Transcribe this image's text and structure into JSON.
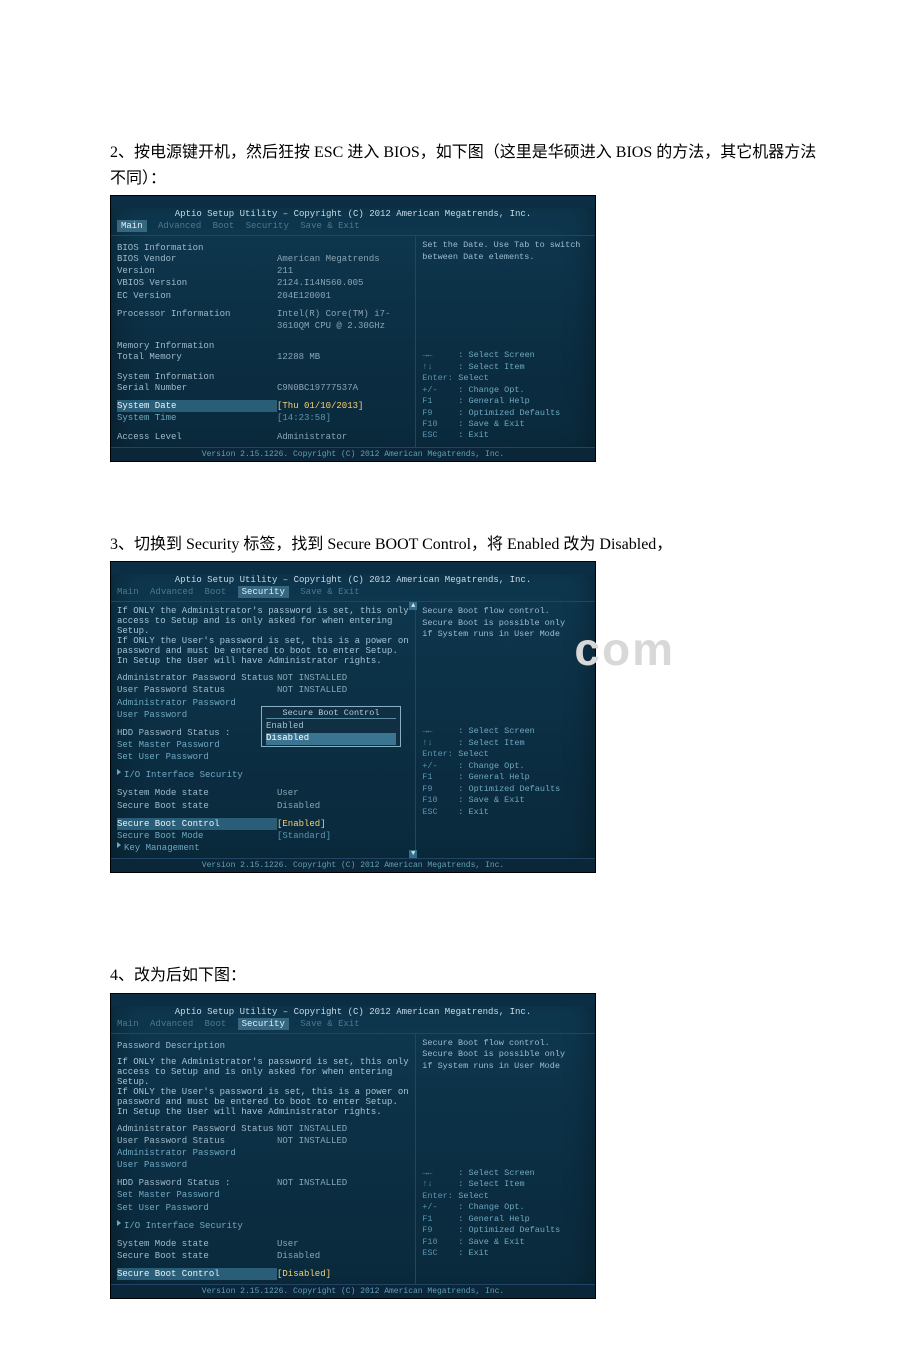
{
  "step2": {
    "caption": "2、按电源键开机，然后狂按 ESC 进入 BIOS，如下图（这里是华硕进入 BIOS 的方法，其它机器方法不同）：",
    "title": "Aptio Setup Utility – Copyright (C) 2012 American Megatrends, Inc.",
    "tabs": {
      "active": "Main",
      "others": [
        "Advanced",
        "Boot",
        "Security",
        "Save & Exit"
      ]
    },
    "left": {
      "h0": "BIOS Information",
      "r1k": "BIOS Vendor",
      "r1v": "American Megatrends",
      "r2k": "Version",
      "r2v": "211",
      "r3k": "VBIOS Version",
      "r3v": "2124.I14N560.005",
      "r4k": "EC Version",
      "r4v": "204E120001",
      "r5k": "Processor Information",
      "r5v": "Intel(R) Core(TM) i7-3610QM CPU @ 2.30GHz",
      "h1": "Memory Information",
      "r6k": "Total Memory",
      "r6v": "12288 MB",
      "h2": "System Information",
      "r7k": "Serial Number",
      "r7v": "C9N0BC19777537A",
      "r8k": "System Date",
      "r8v": "[Thu 01/10/2013]",
      "r9k": "System Time",
      "r9v": "[14:23:58]",
      "r10k": "Access Level",
      "r10v": "Administrator"
    },
    "right": {
      "help": "Set the Date. Use Tab to switch between Date elements.",
      "keys": {
        "k1": "→←",
        "d1": ": Select Screen",
        "k2": "↑↓",
        "d2": ": Select Item",
        "k3": "Enter:",
        "d3": "Select",
        "k4": "+/-",
        "d4": ": Change Opt.",
        "k5": "F1",
        "d5": ": General Help",
        "k6": "F9",
        "d6": ": Optimized Defaults",
        "k7": "F10",
        "d7": ": Save & Exit",
        "k8": "ESC",
        "d8": ": Exit"
      }
    },
    "footer": "Version 2.15.1226. Copyright (C) 2012 American Megatrends, Inc."
  },
  "step3": {
    "caption": "3、切换到 Security 标签，找到 Secure BOOT Control，将 Enabled 改为 Disabled，",
    "title": "Aptio Setup Utility – Copyright (C) 2012 American Megatrends, Inc.",
    "tabs": {
      "active": "Security",
      "before": [
        "Main",
        "Advanced",
        "Boot"
      ],
      "after": [
        "Save & Exit"
      ]
    },
    "desc1": "If ONLY the Administrator's password is set, this only",
    "desc2": "access to Setup and is only asked for when entering Setup.",
    "desc3": "If ONLY the User's password is set, this is a power on",
    "desc4": "password and must be entered to boot to enter Setup.",
    "desc5": "In Setup the User will have Administrator rights.",
    "r1k": "Administrator Password Status",
    "r1v": "NOT INSTALLED",
    "r2k": "User Password Status",
    "r2v": "NOT INSTALLED",
    "r3k": "Administrator Password",
    "r4k": "User Password",
    "r5k": "HDD Password Status   :",
    "r6k": "Set Master Password",
    "r7k": "Set User Password",
    "r8k": "I/O Interface Security",
    "r9k": "System Mode state",
    "r9v": "User",
    "r10k": "Secure Boot state",
    "r10v": "Disabled",
    "r11k": "Secure Boot Control",
    "r11v": "[Enabled]",
    "r12k": "Secure Boot Mode",
    "r12v": "[Standard]",
    "r13k": "Key Management",
    "popup": {
      "title": "Secure Boot Control",
      "opt1": "Enabled",
      "opt2": "Disabled"
    },
    "right": {
      "help1": "Secure Boot flow control.",
      "help2": "Secure Boot is possible only",
      "help3": "if System runs in User Mode",
      "keys": {
        "k1": "→←",
        "d1": ": Select Screen",
        "k2": "↑↓",
        "d2": ": Select Item",
        "k3": "Enter:",
        "d3": "Select",
        "k4": "+/-",
        "d4": ": Change Opt.",
        "k5": "F1",
        "d5": ": General Help",
        "k6": "F9",
        "d6": ": Optimized Defaults",
        "k7": "F10",
        "d7": ": Save & Exit",
        "k8": "ESC",
        "d8": ": Exit"
      }
    },
    "footer": "Version 2.15.1226. Copyright (C) 2012 American Megatrends, Inc.",
    "watermark": "com"
  },
  "step4": {
    "caption": "4、改为后如下图：",
    "title": "Aptio Setup Utility – Copyright (C) 2012 American Megatrends, Inc.",
    "tabs": {
      "active": "Security",
      "before": [
        "Main",
        "Advanced",
        "Boot"
      ],
      "after": [
        "Save & Exit"
      ]
    },
    "h0": "Password Description",
    "desc1": "If ONLY the Administrator's password is set, this only",
    "desc2": "access to Setup and is only asked for when entering Setup.",
    "desc3": "If ONLY the User's password is set, this is a power on",
    "desc4": "password and must be entered to boot to enter Setup.",
    "desc5": "In Setup the User will have Administrator rights.",
    "r1k": "Administrator Password Status",
    "r1v": "NOT INSTALLED",
    "r2k": "User Password Status",
    "r2v": "NOT INSTALLED",
    "r3k": "Administrator Password",
    "r4k": "User Password",
    "r5k": "HDD Password Status   :",
    "r5v": "NOT INSTALLED",
    "r6k": "Set Master Password",
    "r7k": "Set User Password",
    "r8k": "I/O Interface Security",
    "r9k": "System Mode state",
    "r9v": "User",
    "r10k": "Secure Boot state",
    "r10v": "Disabled",
    "r11k": "Secure Boot Control",
    "r11v": "[Disabled]",
    "right": {
      "help1": "Secure Boot flow control.",
      "help2": "Secure Boot is possible only",
      "help3": "if System runs in User Mode",
      "keys": {
        "k1": "→←",
        "d1": ": Select Screen",
        "k2": "↑↓",
        "d2": ": Select Item",
        "k3": "Enter:",
        "d3": "Select",
        "k4": "+/-",
        "d4": ": Change Opt.",
        "k5": "F1",
        "d5": ": General Help",
        "k6": "F9",
        "d6": ": Optimized Defaults",
        "k7": "F10",
        "d7": ": Save & Exit",
        "k8": "ESC",
        "d8": ": Exit"
      }
    },
    "footer": "Version 2.15.1226. Copyright (C) 2012 American Megatrends, Inc."
  }
}
